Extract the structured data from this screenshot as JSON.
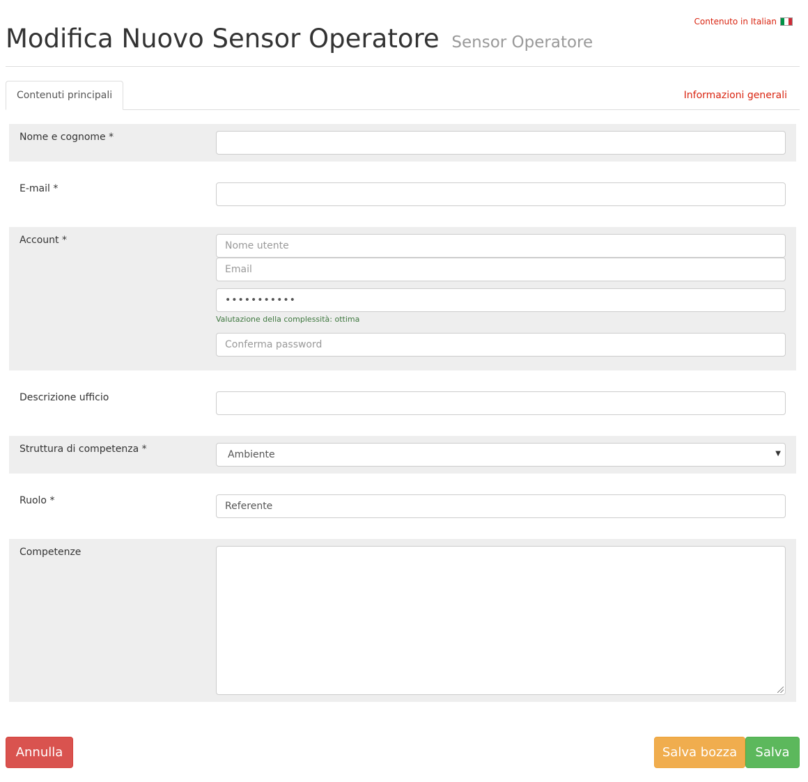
{
  "header": {
    "title": "Modifica Nuovo Sensor Operatore",
    "subtitle": "Sensor Operatore",
    "language_link": "Contenuto in Italian",
    "flag_colors": [
      "#009246",
      "#ffffff",
      "#ce2b37"
    ]
  },
  "tabs": {
    "active": "Contenuti principali",
    "info_link": "Informazioni generali"
  },
  "form": {
    "nome": {
      "label": "Nome e cognome *",
      "value": ""
    },
    "email": {
      "label": "E-mail *",
      "value": ""
    },
    "account": {
      "label": "Account *",
      "username_placeholder": "Nome utente",
      "email_placeholder": "Email",
      "password_value": "•••••••••••",
      "strength": "Valutazione della complessità: ottima",
      "confirm_placeholder": "Conferma password"
    },
    "ufficio": {
      "label": "Descrizione ufficio",
      "value": ""
    },
    "struttura": {
      "label": "Struttura di competenza *",
      "selected": "Ambiente"
    },
    "ruolo": {
      "label": "Ruolo *",
      "value": "Referente"
    },
    "competenze": {
      "label": "Competenze",
      "value": ""
    }
  },
  "buttons": {
    "cancel": "Annulla",
    "draft": "Salva bozza",
    "save": "Salva"
  },
  "colors": {
    "accent": "#d9230f",
    "danger": "#d9534f",
    "warning": "#f0ad4e",
    "success": "#5cb85c",
    "strength_text": "#3c763d"
  }
}
